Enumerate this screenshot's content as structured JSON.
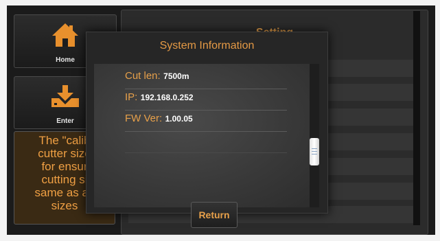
{
  "sidebar": {
    "home_label": "Home",
    "enter_label": "Enter",
    "note_lines": [
      "The \"calib",
      "cutter size",
      "for ensur",
      "cutting si",
      "same as ac",
      "sizes"
    ]
  },
  "main": {
    "title": "Setting"
  },
  "dialog": {
    "title": "System Information",
    "rows": [
      {
        "key": "Cut len:",
        "value": "7500m"
      },
      {
        "key": "IP:",
        "value": "192.168.0.252"
      },
      {
        "key": "FW Ver:",
        "value": "1.00.05"
      }
    ],
    "return_label": "Return"
  },
  "colors": {
    "accent": "#e7a04a",
    "panel": "#262626",
    "background": "#1b1b1b"
  },
  "icons": {
    "home": "home-icon",
    "enter": "download-tray-icon"
  }
}
